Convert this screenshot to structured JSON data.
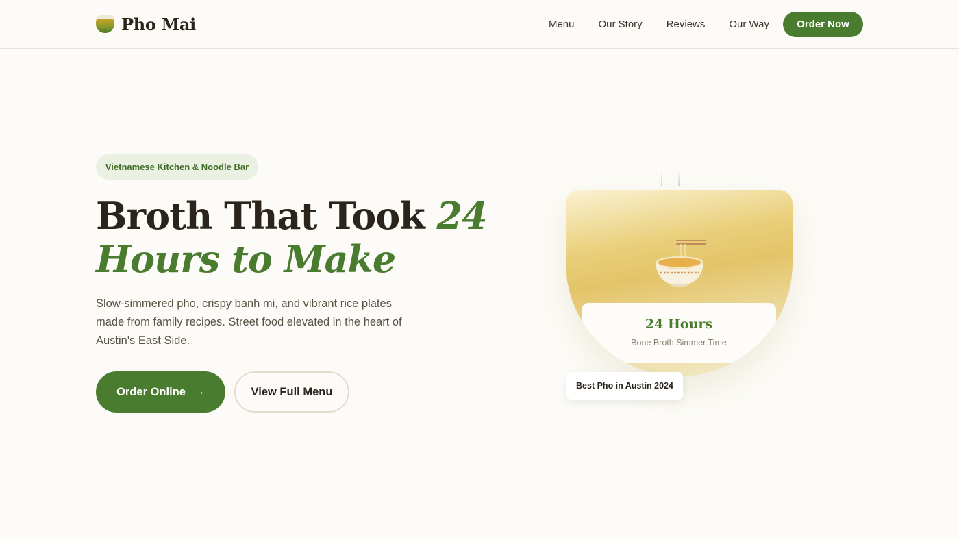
{
  "brand": {
    "name": "Pho Mai"
  },
  "nav": {
    "items": [
      "Menu",
      "Our Story",
      "Reviews",
      "Our Way"
    ],
    "cta": "Order Now"
  },
  "hero": {
    "badge": "Vietnamese Kitchen & Noodle Bar",
    "headline_plain": "Broth That Took ",
    "headline_accent": "24 Hours to Make",
    "subtext": "Slow-simmered pho, crispy banh mi, and vibrant rice plates made from family recipes. Street food elevated in the heart of Austin's East Side.",
    "primary_button": "Order Online",
    "primary_button_icon": "arrow-right-icon",
    "secondary_button": "View Full Menu"
  },
  "visual": {
    "stat_value": "24 Hours",
    "stat_label": "Bone Broth Simmer Time",
    "award": "Best Pho in Austin 2024"
  },
  "colors": {
    "accent": "#4a7c2f",
    "background": "#fcfbf7",
    "badge_bg": "#eaf1e2",
    "broth_gold": "#e3c469",
    "text_dark": "#2a241c"
  }
}
